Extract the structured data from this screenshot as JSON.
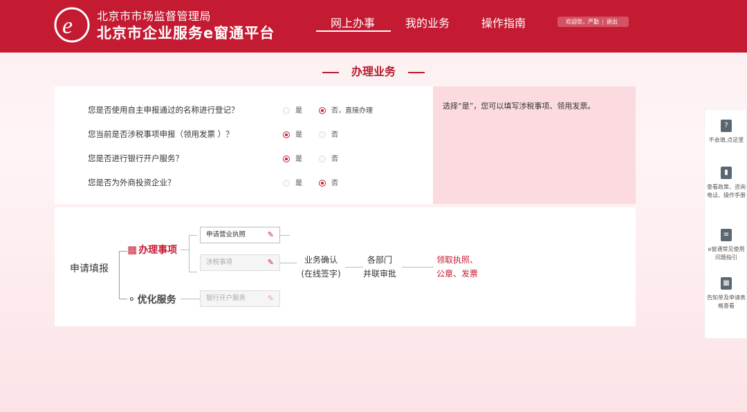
{
  "header": {
    "org": "北京市市场监督管理局",
    "platform": "北京市企业服务e窗通平台",
    "nav": [
      "网上办事",
      "我的业务",
      "操作指南"
    ],
    "welcome": "欢迎您，严勤",
    "logout": "退出"
  },
  "section_title": "办理业务",
  "questions": [
    {
      "text": "您是否使用自主申报通过的名称进行登记？",
      "opt_yes": "是",
      "opt_no": "否，直接办理",
      "selected": "no"
    },
    {
      "text": "您当前是否涉税事项申报（领用发票 ）？",
      "opt_yes": "是",
      "opt_no": "否",
      "selected": "yes"
    },
    {
      "text": "您是否进行银行开户服务？",
      "opt_yes": "是",
      "opt_no": "否",
      "selected": "yes"
    },
    {
      "text": "您是否为外商投资企业？",
      "opt_yes": "是",
      "opt_no": "否",
      "selected": "no"
    }
  ],
  "hint": "选择“是”，您可以填写涉税事项、领用发票。",
  "flow": {
    "apply": "申请填报",
    "cat_handle": "办理事项",
    "cat_optimize": "优化服务",
    "field_license": "申请营业执照",
    "field_tax": "涉税事项",
    "field_bank": "银行开户服务",
    "step1_line1": "业务确认",
    "step1_line2": "(在线签字)",
    "step2_line1": "各部门",
    "step2_line2": "并联审批",
    "result_line1": "领取执照、",
    "result_line2": "公章、发票"
  },
  "sidebar": [
    {
      "label": "不会填,点这里",
      "icon": "question-icon"
    },
    {
      "label": "查看政策、咨询电话、操作手册",
      "icon": "book-icon"
    },
    {
      "label": "e窗通常见使用问题指引",
      "icon": "list-icon"
    },
    {
      "label": "告知单及申请表格查看",
      "icon": "qrcode-icon"
    }
  ],
  "colors": {
    "brand": "#c41a32",
    "hint_bg": "#fbdbe0"
  }
}
